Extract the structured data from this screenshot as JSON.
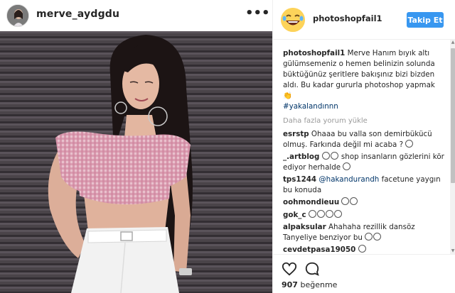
{
  "post": {
    "owner_username": "merve_aydgdu",
    "more_glyph": "•••"
  },
  "sidebar": {
    "account_username": "photoshopfail1",
    "follow_label": "Takip Et",
    "caption": {
      "username": "photoshopfail1",
      "text": "Merve Hanım bıyık altı gülümsemeniz o hemen belinizin solunda büktüğünüz şeritlere bakışınız bizi bizden aldı. Bu kadar gururla photoshop yapmak 👏",
      "hashtag": "#yakalandınnn"
    },
    "load_more": "Daha fazla yorum yükle",
    "comments": [
      {
        "username": "esrstp",
        "text": "Ohaaa bu valla son demirbükücü olmuş. Farkında değil mi acaba ?",
        "emoji": 1
      },
      {
        "username": "_.artblog",
        "text": "shop insanların gözlerini kör ediyor herhalde",
        "emoji": 0
      },
      {
        "username": "tps1244",
        "mention": "@hakandurandh",
        "text": "facetune yaygın bu konuda",
        "emoji": 0
      },
      {
        "username": "oohmondieuu",
        "text": "",
        "emoji": 2
      },
      {
        "username": "gok_c",
        "text": "",
        "emoji": 4
      },
      {
        "username": "alpaksular",
        "text": "Ahahaha rezillik dansöz Tanyeliye benziyor bu",
        "emoji": 2
      },
      {
        "username": "cevdetpasa19050",
        "text": "",
        "emoji": 1
      }
    ],
    "likes_count": "907",
    "likes_label": "beğenme"
  },
  "colors": {
    "follow_button": "#3897f0",
    "link": "#003569",
    "muted": "#999999"
  },
  "icons": [
    "more-options-icon",
    "heart-icon",
    "comment-icon",
    "laughing-emoji-avatar"
  ]
}
